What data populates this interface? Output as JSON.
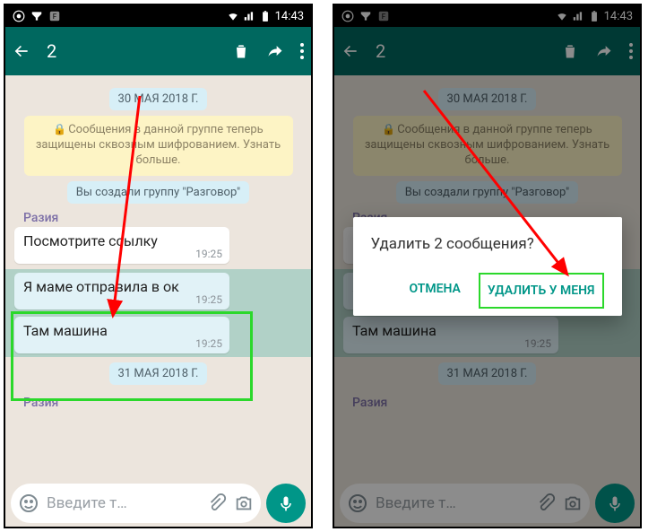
{
  "status": {
    "time": "14:43"
  },
  "toolbar": {
    "count": "2"
  },
  "chat": {
    "date1": "30 МАЯ 2018 Г.",
    "encryption": "Сообщения в данной группе теперь защищены сквозным шифрованием. Узнать больше.",
    "system_created": "Вы создали группу \"Разговор\"",
    "sender": "Разия",
    "msg1": {
      "text": "Посмотрите ссылку",
      "time": "19:25"
    },
    "msg2": {
      "text": "Я маме отправила в ок",
      "time": "19:25"
    },
    "msg3": {
      "text": "Там машина",
      "time": "19:25"
    },
    "date2": "31 МАЯ 2018 Г."
  },
  "input": {
    "placeholder": "Введите т…"
  },
  "dialog": {
    "title": "Удалить 2 сообщения?",
    "cancel": "ОТМЕНА",
    "confirm": "УДАЛИТЬ У МЕНЯ"
  }
}
